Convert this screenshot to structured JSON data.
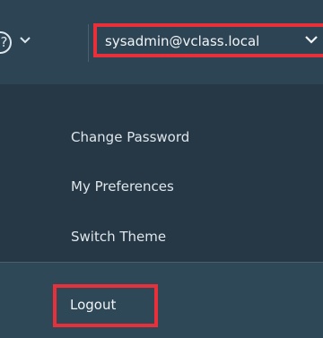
{
  "header": {
    "help_icon_glyph": "?",
    "user_label": "sysadmin@vclass.local"
  },
  "dropdown": {
    "items": [
      {
        "label": "Change Password"
      },
      {
        "label": "My Preferences"
      },
      {
        "label": "Switch Theme"
      }
    ],
    "logout_label": "Logout"
  },
  "colors": {
    "highlight_outline": "#e8303b",
    "header_background": "#2d4454",
    "menu_background": "#263846",
    "logout_background": "#2f4858",
    "text": "#dfe6eb"
  },
  "icons": [
    "help-icon",
    "chevron-down-icon"
  ]
}
